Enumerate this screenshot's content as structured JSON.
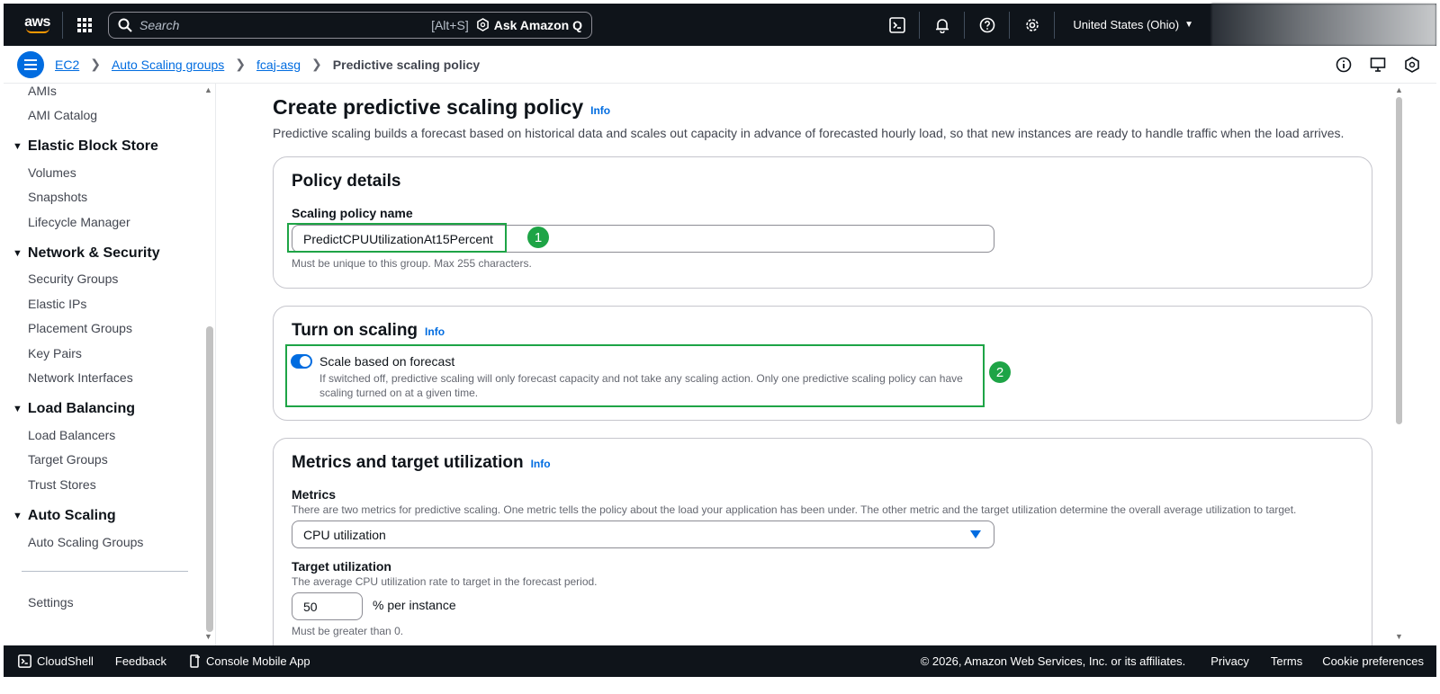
{
  "topbar": {
    "logo_text": "aws",
    "search_placeholder": "Search",
    "search_shortcut": "[Alt+S]",
    "ask_q_label": "Ask Amazon Q",
    "region_label": "United States (Ohio)"
  },
  "breadcrumb": {
    "items": [
      "EC2",
      "Auto Scaling groups",
      "fcaj-asg"
    ],
    "current": "Predictive scaling policy"
  },
  "sidebar": {
    "items_top": [
      "AMIs",
      "AMI Catalog"
    ],
    "sections": [
      {
        "title": "Elastic Block Store",
        "items": [
          "Volumes",
          "Snapshots",
          "Lifecycle Manager"
        ]
      },
      {
        "title": "Network & Security",
        "items": [
          "Security Groups",
          "Elastic IPs",
          "Placement Groups",
          "Key Pairs",
          "Network Interfaces"
        ]
      },
      {
        "title": "Load Balancing",
        "items": [
          "Load Balancers",
          "Target Groups",
          "Trust Stores"
        ]
      },
      {
        "title": "Auto Scaling",
        "items": [
          "Auto Scaling Groups"
        ]
      }
    ],
    "settings_label": "Settings"
  },
  "main": {
    "title": "Create predictive scaling policy",
    "info_label": "Info",
    "description": "Predictive scaling builds a forecast based on historical data and scales out capacity in advance of forecasted hourly load, so that new instances are ready to handle traffic when the load arrives.",
    "policy_details": {
      "title": "Policy details",
      "name_label": "Scaling policy name",
      "name_value": "PredictCPUUtilizationAt15Percent",
      "name_hint": "Must be unique to this group. Max 255 characters.",
      "badge": "1"
    },
    "turn_on_scaling": {
      "title": "Turn on scaling",
      "info_label": "Info",
      "toggle_label": "Scale based on forecast",
      "toggle_on": true,
      "toggle_desc_1": "If switched off, predictive scaling will only forecast capacity and not take any scaling action. Only one predictive scaling policy can have",
      "toggle_desc_2": "scaling turned on at a given time.",
      "badge": "2"
    },
    "metrics": {
      "title": "Metrics and target utilization",
      "info_label": "Info",
      "metrics_label": "Metrics",
      "metrics_desc": "There are two metrics for predictive scaling. One metric tells the policy about the load your application has been under. The other metric and the target utilization determine the overall average utilization to target.",
      "metrics_value": "CPU utilization",
      "target_label": "Target utilization",
      "target_desc": "The average CPU utilization rate to target in the forecast period.",
      "target_value": "50",
      "target_unit": "% per instance",
      "target_hint": "Must be greater than 0."
    }
  },
  "footer": {
    "cloudshell": "CloudShell",
    "feedback": "Feedback",
    "mobile_app": "Console Mobile App",
    "copyright": "© 2026, Amazon Web Services, Inc. or its affiliates.",
    "privacy": "Privacy",
    "terms": "Terms",
    "cookie": "Cookie preferences"
  },
  "colors": {
    "accent": "#006ce0",
    "highlight": "#1ea446",
    "topbar_bg": "#0f141a"
  }
}
